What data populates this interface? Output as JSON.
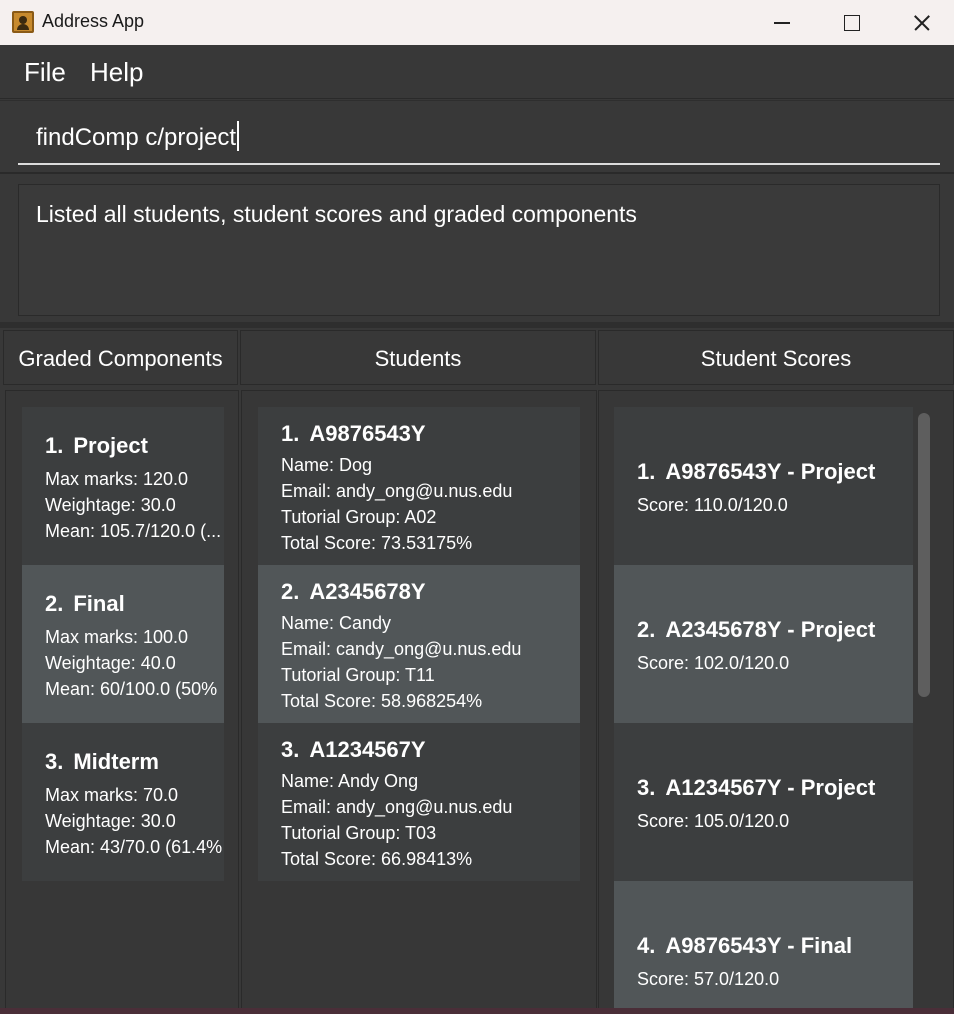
{
  "window": {
    "title": "Address App"
  },
  "menu": {
    "file": "File",
    "help": "Help"
  },
  "command": {
    "value": "findComp c/project"
  },
  "result": {
    "text": "Listed all students, student scores and graded components"
  },
  "headers": {
    "components": "Graded Components",
    "students": "Students",
    "scores": "Student Scores"
  },
  "components": [
    {
      "index": "1.",
      "name": "Project",
      "max": "Max marks: 120.0",
      "weight": "Weightage: 30.0",
      "mean": "Mean: 105.7/120.0 (..."
    },
    {
      "index": "2.",
      "name": "Final",
      "max": "Max marks: 100.0",
      "weight": "Weightage: 40.0",
      "mean": "Mean: 60/100.0 (50%"
    },
    {
      "index": "3.",
      "name": "Midterm",
      "max": "Max marks: 70.0",
      "weight": "Weightage: 30.0",
      "mean": "Mean: 43/70.0 (61.4%"
    }
  ],
  "students": [
    {
      "index": "1.",
      "id": "A9876543Y",
      "name": "Name: Dog",
      "email": "Email: andy_ong@u.nus.edu",
      "tutorial": "Tutorial Group: A02",
      "total": "Total Score: 73.53175%"
    },
    {
      "index": "2.",
      "id": "A2345678Y",
      "name": "Name: Candy",
      "email": "Email: candy_ong@u.nus.edu",
      "tutorial": "Tutorial Group: T11",
      "total": "Total Score: 58.968254%"
    },
    {
      "index": "3.",
      "id": "A1234567Y",
      "name": "Name: Andy Ong",
      "email": "Email: andy_ong@u.nus.edu",
      "tutorial": "Tutorial Group: T03",
      "total": "Total Score: 66.98413%"
    }
  ],
  "scores": [
    {
      "index": "1.",
      "title": "A9876543Y - Project",
      "score": "Score: 110.0/120.0"
    },
    {
      "index": "2.",
      "title": "A2345678Y - Project",
      "score": "Score: 102.0/120.0"
    },
    {
      "index": "3.",
      "title": "A1234567Y - Project",
      "score": "Score: 105.0/120.0"
    },
    {
      "index": "4.",
      "title": "A9876543Y - Final",
      "score": "Score: 57.0/120.0"
    }
  ]
}
